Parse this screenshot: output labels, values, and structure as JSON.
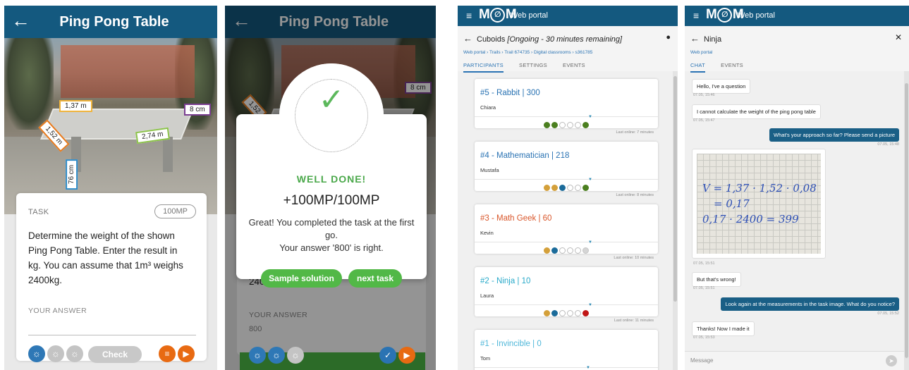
{
  "colors": {
    "header": "#14597f",
    "accent_green": "#4cb845",
    "link_blue": "#2a73b3",
    "orange": "#e86a12"
  },
  "phone1": {
    "title": "Ping Pong Table",
    "measurements": [
      "1,37 m",
      "8 cm",
      "1,52 m",
      "2,74 m",
      "76 cm"
    ],
    "task_label": "TASK",
    "task_points": "100MP",
    "task_text": "Determine the weight of the shown Ping Pong Table. Enter the result in kg. You can assume that 1m³ weighs 2400kg.",
    "answer_label": "YOUR ANSWER",
    "check_label": "Check",
    "icons": [
      "hint-bulb-icon",
      "hint-bulb-icon",
      "hint-bulb-icon",
      "list-icon",
      "skip-icon"
    ]
  },
  "phone2": {
    "title": "Ping Pong Table",
    "measurements": [
      "8 cm",
      "1,52"
    ],
    "partial_answer": "240",
    "well_done": "WELL DONE!",
    "score": "+100MP/100MP",
    "message_line1": "Great! You completed the task at the first go.",
    "message_line2": "Your answer '800' is right.",
    "sample_solution_label": "Sample solution",
    "next_task_label": "next task",
    "answer_label": "YOUR ANSWER",
    "answer_value": "800"
  },
  "portal1": {
    "brand": "M⊘M",
    "portal_label": "Web portal",
    "title": "Cuboids",
    "status": "[Ongoing - 30 minutes remaining]",
    "breadcrumbs": "Web portal  ›  Trails  ›  Trail 674735  ›  Digital classrooms  ›  s361785",
    "tabs": [
      "PARTICIPANTS",
      "SETTINGS",
      "EVENTS"
    ],
    "participants": [
      {
        "title": "#5 - Rabbit | 300",
        "name": "Chiara",
        "color": "#2a73b3",
        "dots": [
          "green",
          "green",
          "empty",
          "empty",
          "empty",
          "green"
        ],
        "last_online": "Last online: 7 minutes"
      },
      {
        "title": "#4 - Mathematician | 218",
        "name": "Mustafa",
        "color": "#2a73b3",
        "dots": [
          "gold",
          "gold",
          "blue",
          "empty",
          "empty",
          "green"
        ],
        "last_online": "Last online: 8 minutes"
      },
      {
        "title": "#3 - Math Geek | 60",
        "name": "Kevin",
        "color": "#d9562a",
        "dots": [
          "gold",
          "blue",
          "empty",
          "empty",
          "empty",
          "lightgrey"
        ],
        "last_online": "Last online: 10 minutes"
      },
      {
        "title": "#2 - Ninja | 10",
        "name": "Laura",
        "color": "#27a9c9",
        "dots": [
          "gold",
          "blue",
          "empty",
          "empty",
          "empty",
          "red"
        ],
        "last_online": "Last online: 11 minutes"
      },
      {
        "title": "#1 - Invincible | 0",
        "name": "Tom",
        "color": "#4fb7d9",
        "dots": [],
        "last_online": ""
      }
    ]
  },
  "portal2": {
    "brand": "M⊘M",
    "portal_label": "Web portal",
    "title": "Ninja",
    "breadcrumbs": "Web portal",
    "tabs": [
      "CHAT",
      "EVENTS"
    ],
    "messages": [
      {
        "dir": "in",
        "text": "Hello, I've a question",
        "time": "07.05, 15:46"
      },
      {
        "dir": "in",
        "text": "I cannot calculate the weight of the ping pong table",
        "time": "07.05, 15:47"
      },
      {
        "dir": "out",
        "text": "What's your approach so far? Please send a picture",
        "time": "07.05, 15:48"
      },
      {
        "dir": "in",
        "text": "",
        "time": "07.05, 15:51"
      },
      {
        "dir": "in",
        "text": "But that's wrong!",
        "time": "07.05, 15:51"
      },
      {
        "dir": "out",
        "text": "Look again at the measurements in the task image. What do you notice?",
        "time": "07.05, 15:52"
      },
      {
        "dir": "in",
        "text": "Thanks! Now I made it",
        "time": "07.05, 15:53"
      }
    ],
    "handwriting": [
      "V = 1,37 · 1,52 · 0,08",
      "= 0,17",
      "0,17 · 2400 = 399"
    ],
    "message_placeholder": "Message"
  }
}
